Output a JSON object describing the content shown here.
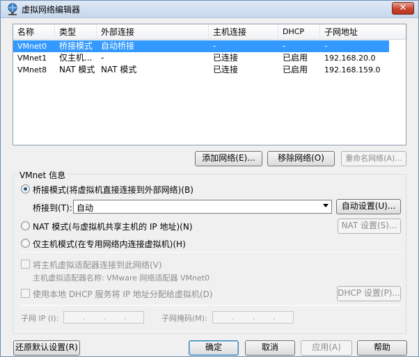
{
  "window": {
    "title": "虚拟网络编辑器",
    "close_label": "✕"
  },
  "list": {
    "columns": [
      "名称",
      "类型",
      "外部连接",
      "主机连接",
      "DHCP",
      "子网地址"
    ],
    "rows": [
      {
        "name": "VMnet0",
        "type": "桥接模式",
        "external": "自动桥接",
        "host": "-",
        "dhcp": "-",
        "subnet": "-",
        "selected": true
      },
      {
        "name": "VMnet1",
        "type": "仅主机...",
        "external": "-",
        "host": "已连接",
        "dhcp": "已启用",
        "subnet": "192.168.20.0",
        "selected": false
      },
      {
        "name": "VMnet8",
        "type": "NAT 模式",
        "external": "NAT 模式",
        "host": "已连接",
        "dhcp": "已启用",
        "subnet": "192.168.159.0",
        "selected": false
      }
    ]
  },
  "list_buttons": {
    "add": "添加网络(E)...",
    "remove": "移除网络(O)",
    "rename": "重命名网络(A)..."
  },
  "vmnet_info": {
    "group_title": "VMnet 信息",
    "bridged_label": "桥接模式(将虚拟机直接连接到外部网络)(B)",
    "bridged_to_label": "桥接到(T):",
    "bridged_to_value": "自动",
    "auto_settings": "自动设置(U)...",
    "nat_label": "NAT 模式(与虚拟机共享主机的 IP 地址)(N)",
    "nat_settings": "NAT 设置(S)...",
    "hostonly_label": "仅主机模式(在专用网络内连接虚拟机)(H)",
    "connect_adapter_label": "将主机虚拟适配器连接到此网络(V)",
    "adapter_name_label": "主机虚拟适配器名称: VMware 网络适配器 VMnet0",
    "dhcp_label": "使用本地 DHCP 服务将 IP 地址分配给虚拟机(D)",
    "dhcp_settings": "DHCP 设置(P)...",
    "subnet_ip_label": "子网 IP (I):",
    "subnet_mask_label": "子网掩码(M):",
    "bridged_selected": true
  },
  "footer": {
    "restore": "还原默认设置(R)",
    "ok": "确定",
    "cancel": "取消",
    "apply": "应用(A)",
    "help": "帮助"
  },
  "colors": {
    "selection": "#3399ff",
    "title_bar": "#c7d8ec",
    "close_button": "#c7452f"
  }
}
